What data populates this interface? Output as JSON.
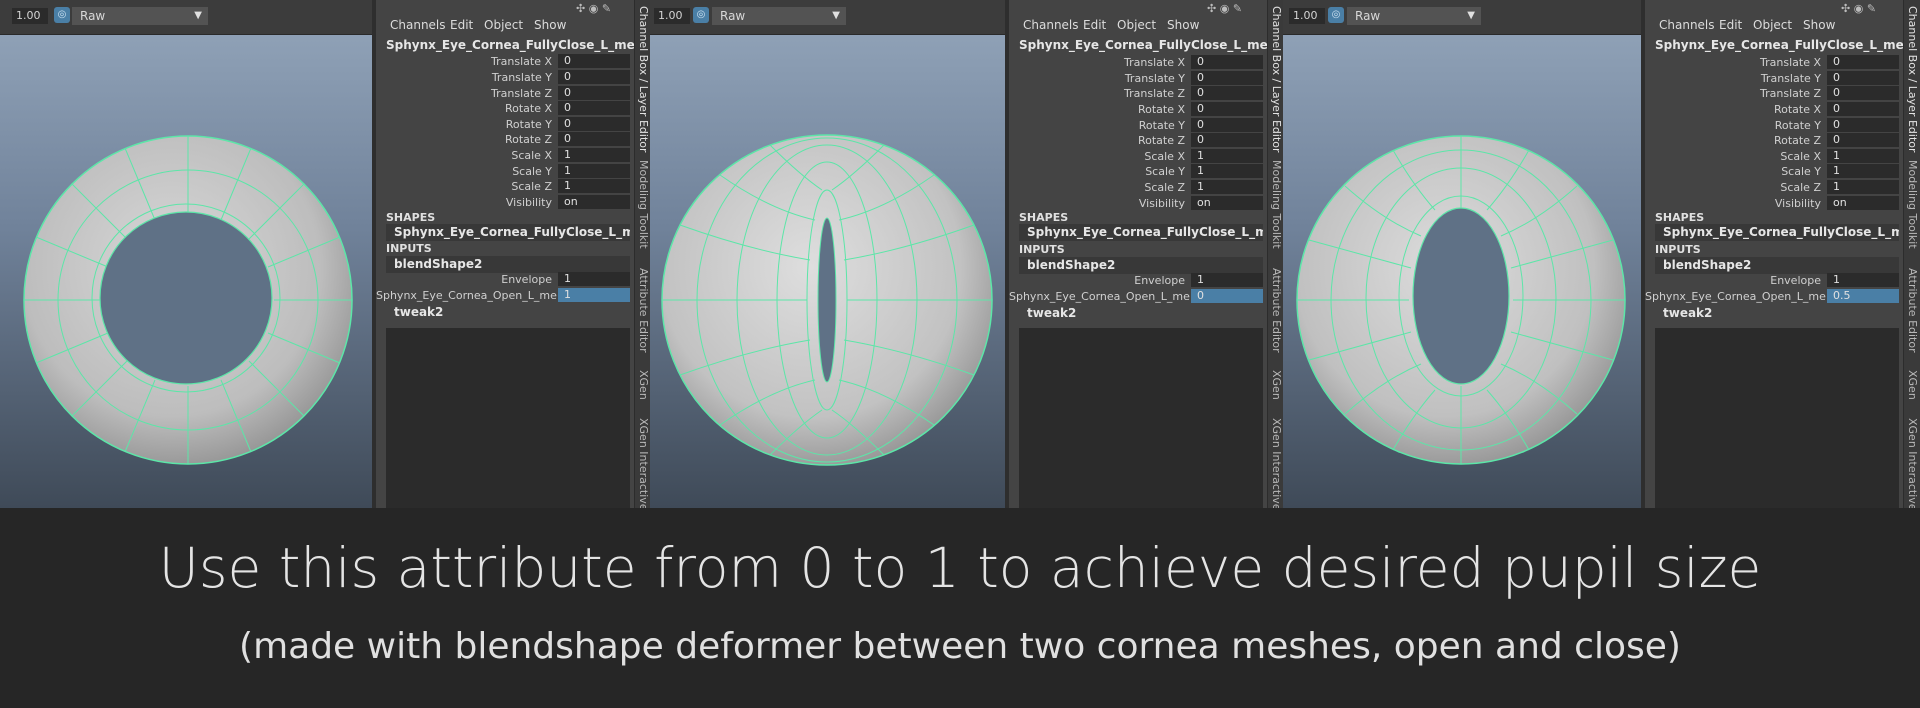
{
  "viewports": [
    {
      "zoom": "1.00",
      "color_space": "Raw"
    },
    {
      "zoom": "1.00",
      "color_space": "Raw"
    },
    {
      "zoom": "1.00",
      "color_space": "Raw"
    },
    {
      "zoom": "",
      "color_space": ""
    }
  ],
  "channel_box": {
    "menu": [
      "Channels",
      "Edit",
      "Object",
      "Show"
    ],
    "object_name": "Sphynx_Eye_Cornea_FullyClose_L_mesh",
    "attributes": [
      {
        "label": "Translate X",
        "value": "0"
      },
      {
        "label": "Translate Y",
        "value": "0"
      },
      {
        "label": "Translate Z",
        "value": "0"
      },
      {
        "label": "Rotate X",
        "value": "0"
      },
      {
        "label": "Rotate Y",
        "value": "0"
      },
      {
        "label": "Rotate Z",
        "value": "0"
      },
      {
        "label": "Scale X",
        "value": "1"
      },
      {
        "label": "Scale Y",
        "value": "1"
      },
      {
        "label": "Scale Z",
        "value": "1"
      },
      {
        "label": "Visibility",
        "value": "on"
      }
    ],
    "shapes_header": "SHAPES",
    "shape_name": "Sphynx_Eye_Cornea_FullyClose_L_mes...",
    "inputs_header": "INPUTS",
    "blend_node": "blendShape2",
    "envelope_label": "Envelope",
    "envelope_value": "1",
    "target_label": "Sphynx_Eye_Cornea_Open_L_me...",
    "tweak_node": "tweak2",
    "side_tabs": [
      "Channel Box / Layer Editor",
      "Modeling Toolkit",
      "Attribute Editor",
      "XGen",
      "XGen Interactive G"
    ]
  },
  "panels": [
    {
      "target_value": "1"
    },
    {
      "target_value": "0"
    },
    {
      "target_value": "0.5"
    }
  ],
  "caption": {
    "line1": "Use this attribute from 0 to 1 to achieve desired pupil size",
    "line2": "(made with blendshape deformer between two cornea meshes, open and close)"
  },
  "colors": {
    "wire": "#5ce6a8",
    "highlight": "#4a7fa6",
    "panel_bg": "#444444"
  }
}
